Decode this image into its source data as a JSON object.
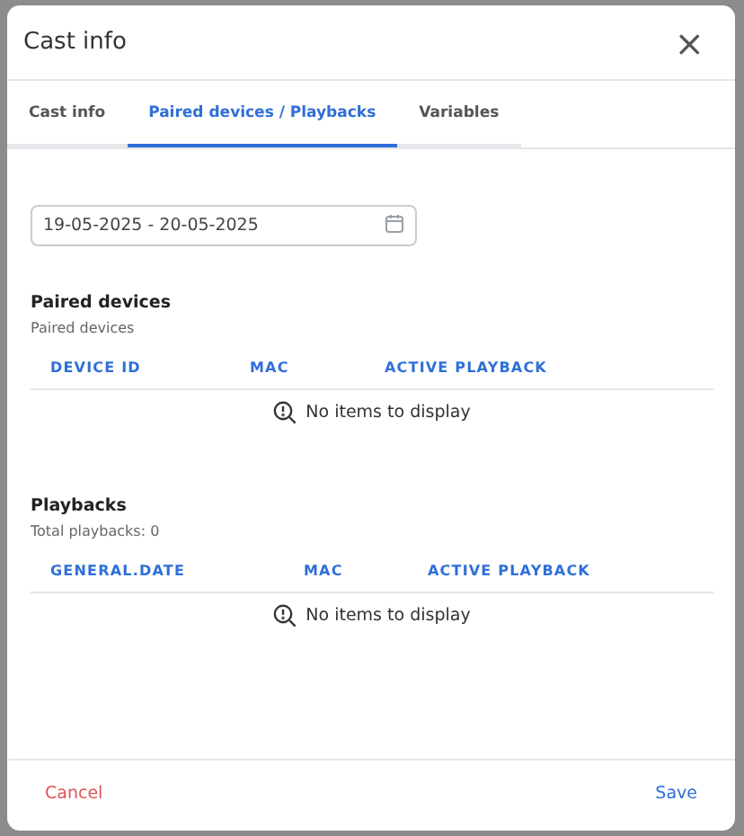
{
  "dialog": {
    "title": "Cast info",
    "close_icon": "×"
  },
  "tabs": [
    {
      "label": "Cast info",
      "selected": false
    },
    {
      "label": "Paired devices / Playbacks",
      "selected": true
    },
    {
      "label": "Variables",
      "selected": false
    }
  ],
  "date_range": {
    "value": "19-05-2025 - 20-05-2025"
  },
  "sections": [
    {
      "title": "Paired devices",
      "subtitle": "Paired devices",
      "columns": [
        "DEVICE ID",
        "MAC",
        "ACTIVE PLAYBACK"
      ],
      "empty_text": "No items to display"
    },
    {
      "title": "Playbacks",
      "subtitle": "Total playbacks: 0",
      "columns": [
        "GENERAL.DATE",
        "MAC",
        "ACTIVE PLAYBACK"
      ],
      "empty_text": "No items to display"
    }
  ],
  "footer": {
    "cancel": "Cancel",
    "save": "Save"
  }
}
